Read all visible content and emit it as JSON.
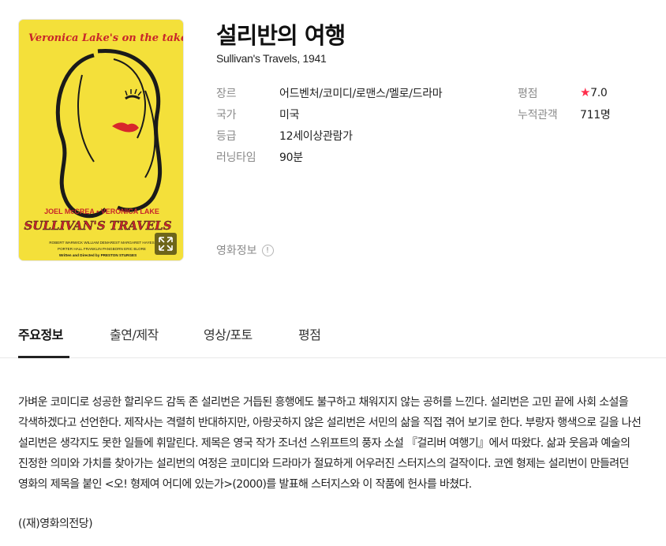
{
  "poster": {
    "tagline": "Veronica Lake's on the take",
    "billing_names": "JOEL McCREA • VERONICA LAKE",
    "poster_title": "SULLIVAN'S TRAVELS",
    "cast_line1": "ROBERT WARWICK  WILLIAM DEMAREST  MARGARET HAYES",
    "cast_line2": "PORTER HALL  FRANKLIN PANGBORN  ERIC BLORE",
    "director_line": "Written and Directed by PRESTON STURGES",
    "bg_color": "#f4e03a",
    "title_color": "#c8252a"
  },
  "movie": {
    "title": "설리반의 여행",
    "original_title_year": "Sullivan's Travels, 1941"
  },
  "info": {
    "genre_label": "장르",
    "genre_value": "어드벤처/코미디/로맨스/멜로/드라마",
    "country_label": "국가",
    "country_value": "미국",
    "rating_label": "등급",
    "rating_value": "12세이상관람가",
    "runtime_label": "러닝타임",
    "runtime_value": "90분",
    "score_label": "평점",
    "score_star": "★",
    "score_value": "7.0",
    "audience_label": "누적관객",
    "audience_value": "711명",
    "star_color": "#ff2d4b"
  },
  "movie_info_link": {
    "label": "영화정보",
    "icon": "!"
  },
  "tabs": [
    {
      "label": "주요정보",
      "active": true
    },
    {
      "label": "출연/제작",
      "active": false
    },
    {
      "label": "영상/포토",
      "active": false
    },
    {
      "label": "평점",
      "active": false
    }
  ],
  "synopsis": {
    "text": "가벼운 코미디로 성공한 할리우드 감독 존 설리번은 거듭된 흥행에도 불구하고 채워지지 않는 공허를 느낀다. 설리번은 고민 끝에 사회 소설을 각색하겠다고 선언한다. 제작사는 격렬히 반대하지만, 아랑곳하지 않은 설리번은 서민의 삶을 직접 겪어 보기로 한다. 부랑자 행색으로 길을 나선 설리번은 생각지도 못한 일들에 휘말린다. 제목은 영국 작가 조너선 스위프트의 풍자 소설 『걸리버 여행기』에서 따왔다. 삶과 웃음과 예술의 진정한 의미와 가치를 찾아가는 설리번의 여정은 코미디와 드라마가 절묘하게 어우러진 스터지스의 걸작이다. 코엔 형제는 설리번이 만들려던 영화의 제목을 붙인 <오! 형제여 어디에 있는가>(2000)를 발표해 스터지스와 이 작품에 헌사를 바쳤다.",
    "credit": "((재)영화의전당)"
  }
}
